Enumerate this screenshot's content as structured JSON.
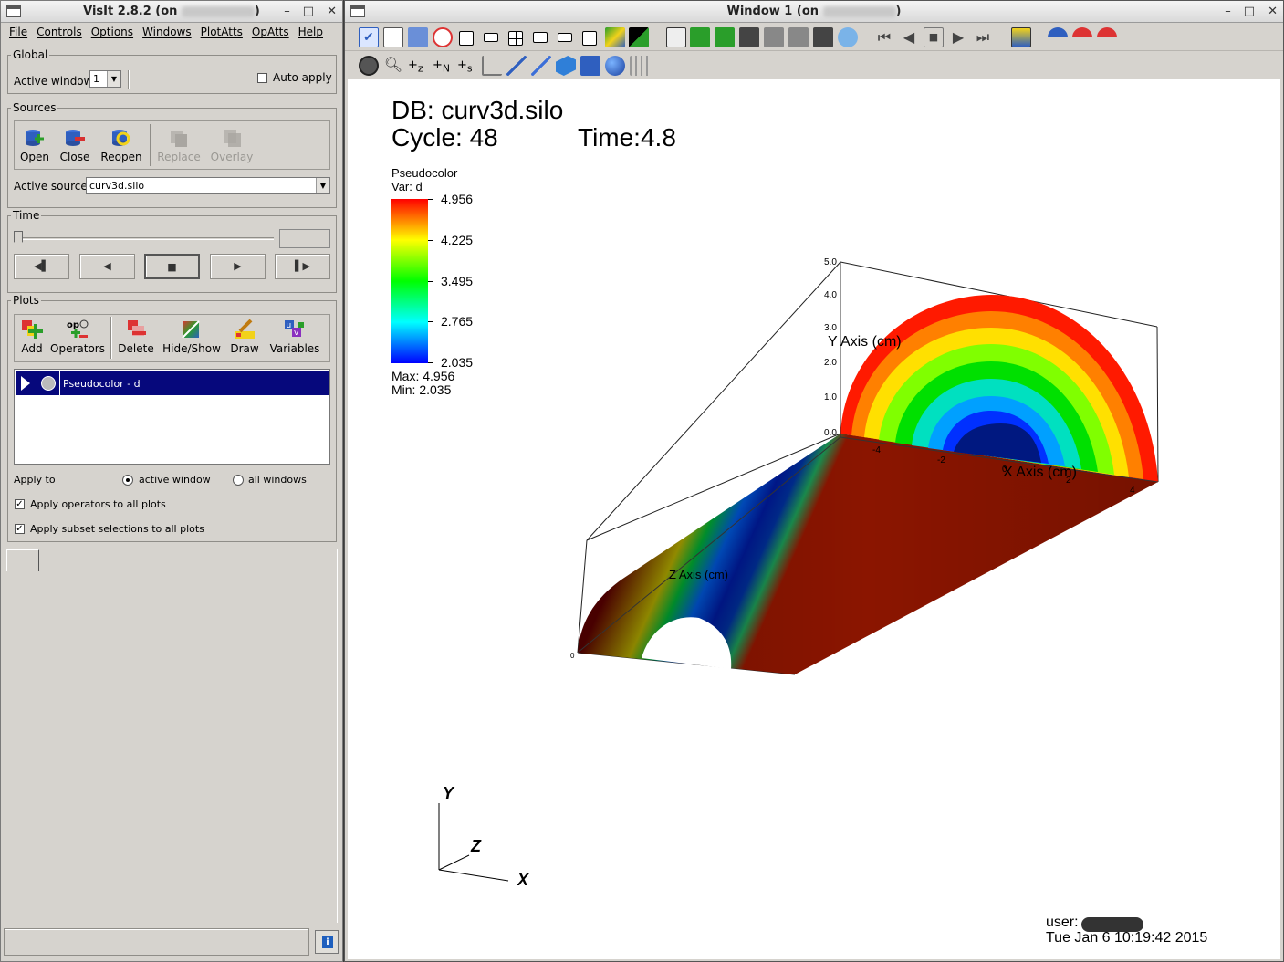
{
  "gui": {
    "title": "VisIt 2.8.2 (on ",
    "title_end": ")",
    "menus": [
      "File",
      "Controls",
      "Options",
      "Windows",
      "PlotAtts",
      "OpAtts",
      "Help"
    ],
    "global_legend": "Global",
    "active_window_label": "Active window",
    "active_window_value": "1",
    "auto_apply_label": "Auto apply",
    "sources_legend": "Sources",
    "source_buttons": {
      "open": "Open",
      "close": "Close",
      "reopen": "Reopen",
      "replace": "Replace",
      "overlay": "Overlay"
    },
    "active_source_label": "Active source",
    "active_source_value": "curv3d.silo",
    "time_legend": "Time",
    "vcr": {
      "back": "◀▌",
      "rev": "◀",
      "stop": "■",
      "play": "▶",
      "fwd": "▌▶"
    },
    "plots_legend": "Plots",
    "plot_buttons": {
      "add": "Add",
      "operators": "Operators",
      "delete": "Delete",
      "hideshow": "Hide/Show",
      "draw": "Draw",
      "variables": "Variables"
    },
    "plot_items": [
      "Pseudocolor - d"
    ],
    "apply_to_label": "Apply to",
    "active_window_radio": "active window",
    "all_windows_radio": "all windows",
    "apply_ops_label": "Apply operators to all plots",
    "apply_subset_label": "Apply subset selections to all plots"
  },
  "viewer": {
    "title": "Window 1 (on ",
    "title_end": ")",
    "db_label": "DB: curv3d.silo",
    "cycle_label": "Cycle: 48",
    "time_label": "Time:4.8",
    "legend_plot": "Pseudocolor",
    "legend_var": "Var: d",
    "legend_ticks": [
      "4.956",
      "4.225",
      "3.495",
      "2.765",
      "2.035"
    ],
    "legend_max": "Max:  4.956",
    "legend_min": "Min:  2.035",
    "y_axis_title": "Y Axis (cm)",
    "x_axis_title": "X Axis (cm)",
    "z_axis_title": "Z Axis (cm)",
    "y_ticks": [
      "5.0",
      "4.0",
      "3.0",
      "2.0",
      "1.0",
      "0.0"
    ],
    "x_ticks": [
      "-4",
      "-2",
      "0",
      "2",
      "4"
    ],
    "origin_tick": "0",
    "triad": {
      "x": "X",
      "y": "Y",
      "z": "Z"
    },
    "user_label": "user:",
    "date_label": "Tue Jan  6 10:19:42 2015"
  },
  "colors": {
    "selection": "#06087c",
    "panel": "#d6d3ce",
    "colorbar": [
      "#ff0000",
      "#ffff00",
      "#00ff00",
      "#00ffff",
      "#0000ff"
    ]
  }
}
